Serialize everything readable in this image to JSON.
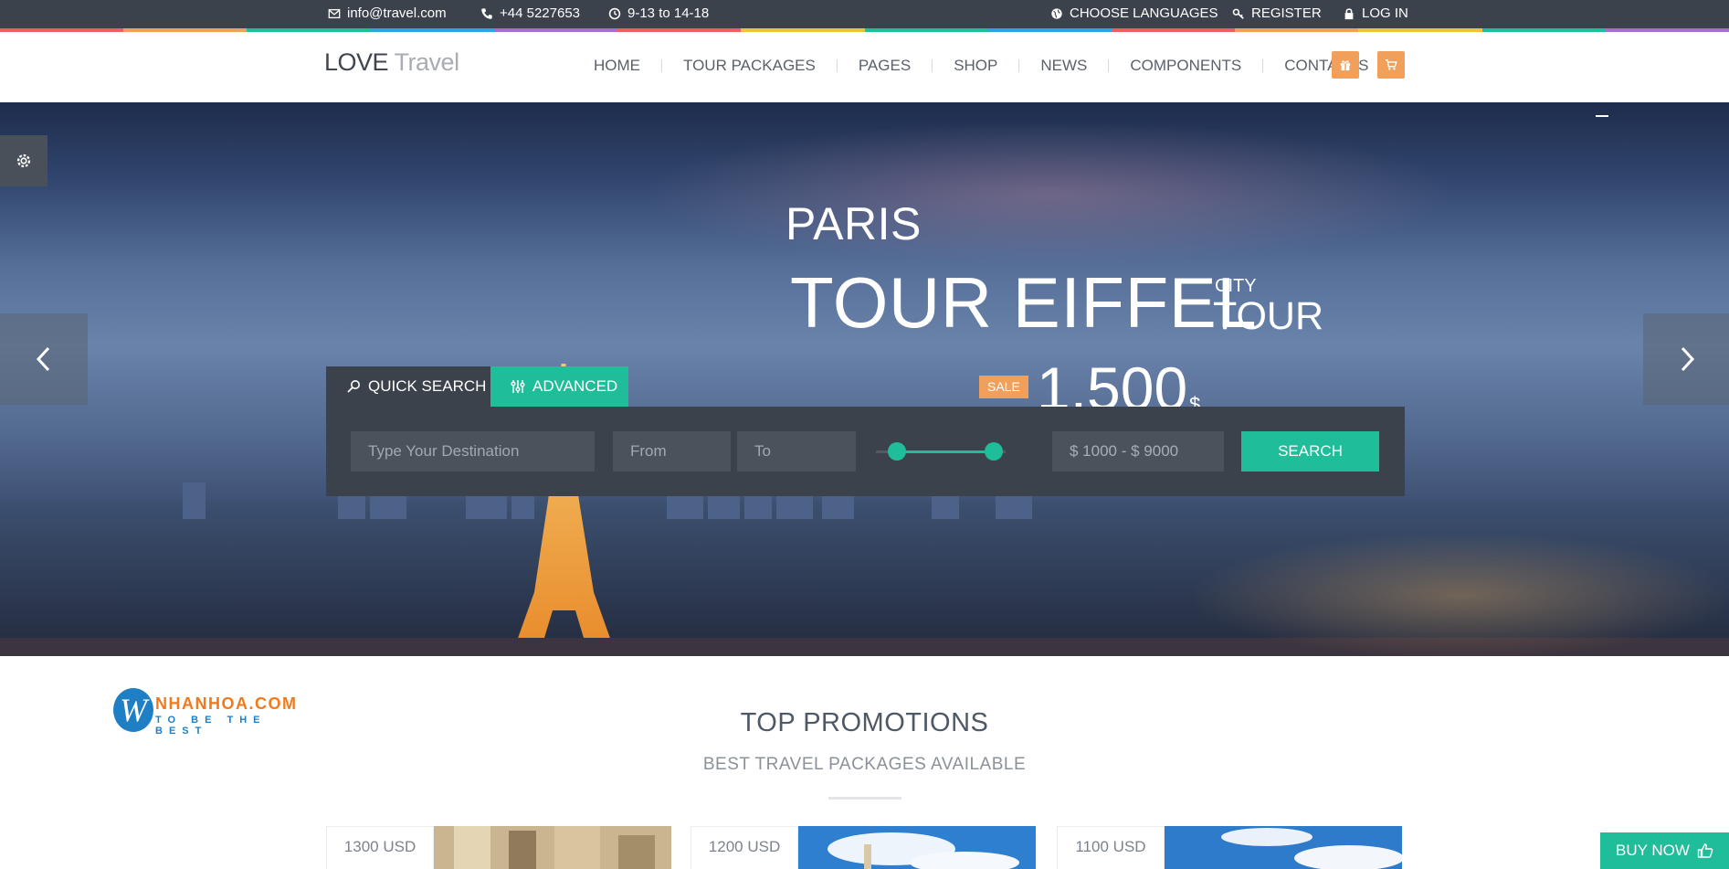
{
  "topbar": {
    "email": "info@travel.com",
    "phone": "+44 5227653",
    "hours": "9-13 to 14-18",
    "languages": "CHOOSE LANGUAGES",
    "register": "REGISTER",
    "login": "LOG IN",
    "stripe_colors": [
      "#e8615e",
      "#f0a05a",
      "#1fbd99",
      "#2ea3dd",
      "#a86bd0",
      "#e8615e",
      "#f0c23a",
      "#1fbd99",
      "#2ea3dd",
      "#e8615e",
      "#f0a05a",
      "#f0c23a",
      "#1fbd99",
      "#a86bd0"
    ]
  },
  "header": {
    "logo_main": "LOVE",
    "logo_sub": "Travel",
    "nav": [
      "HOME",
      "TOUR PACKAGES",
      "PAGES",
      "SHOP",
      "NEWS",
      "COMPONENTS",
      "CONTACTS"
    ],
    "gift_icon": "gift-icon",
    "cart_icon": "cart-icon"
  },
  "hero": {
    "city": "PARIS",
    "title": "TOUR EIFFEL",
    "tag_small": "CITY",
    "tag_large": "TOUR",
    "sale_label": "SALE",
    "price": "1.500",
    "currency": "$"
  },
  "search": {
    "quick_tab": "QUICK SEARCH",
    "advanced_tab": "ADVANCED",
    "destination_placeholder": "Type Your Destination",
    "from_placeholder": "From",
    "to_placeholder": "To",
    "price_range": "$ 1000 - $ 9000",
    "button": "SEARCH",
    "range_min_fraction": 0.16,
    "range_max_fraction": 0.91
  },
  "watermark": {
    "letter": "W",
    "name": "NHANHOA.COM",
    "slogan": "TO BE THE BEST"
  },
  "promotions": {
    "title": "TOP PROMOTIONS",
    "subtitle": "BEST TRAVEL PACKAGES AVAILABLE",
    "cards": [
      {
        "price": "1300 USD"
      },
      {
        "price": "1200 USD"
      },
      {
        "price": "1100 USD"
      }
    ]
  },
  "buy_now": "BUY NOW",
  "colors": {
    "accent": "#1fbd99",
    "orange": "#f0a05a",
    "dark": "#3c424b"
  }
}
